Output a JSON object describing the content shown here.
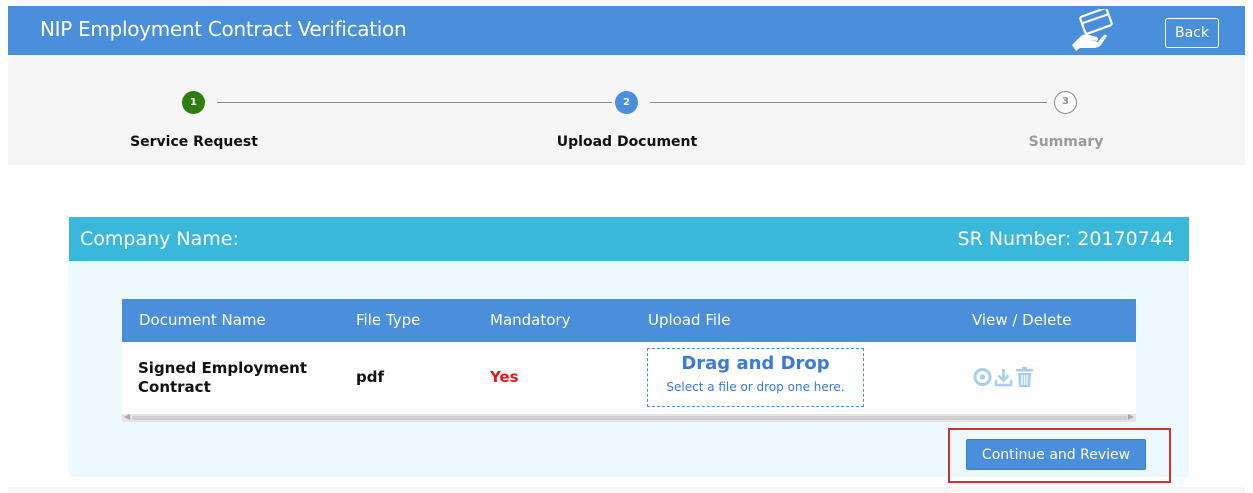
{
  "header": {
    "title": "NIP Employment Contract Verification",
    "icon": "card-hand-icon",
    "back_label": "Back"
  },
  "steps": [
    {
      "number": "1",
      "label": "Service Request",
      "state": "complete",
      "color": "#2e7d0f"
    },
    {
      "number": "2",
      "label": "Upload Document",
      "state": "active",
      "color": "#4a8fdc"
    },
    {
      "number": "3",
      "label": "Summary",
      "state": "pending",
      "color": "#9a9a9a"
    }
  ],
  "panel": {
    "company_label": "Company Name:",
    "sr_label": "SR Number: 20170744"
  },
  "table": {
    "columns": [
      "Document Name",
      "File Type",
      "Mandatory",
      "Upload File",
      "View / Delete"
    ],
    "rows": [
      {
        "document_name": "Signed Employment Contract",
        "file_type": "pdf",
        "mandatory": "Yes",
        "upload_title": "Drag and Drop",
        "upload_hint": "Select a file or drop one here.",
        "actions": [
          "view-icon",
          "download-icon",
          "delete-icon"
        ]
      }
    ]
  },
  "continue_label": "Continue and Review",
  "colors": {
    "header": "#4a8fdc",
    "panel_head": "#3ab8dc",
    "mandatory": "#e31919",
    "highlight_box": "#d32f2f"
  }
}
